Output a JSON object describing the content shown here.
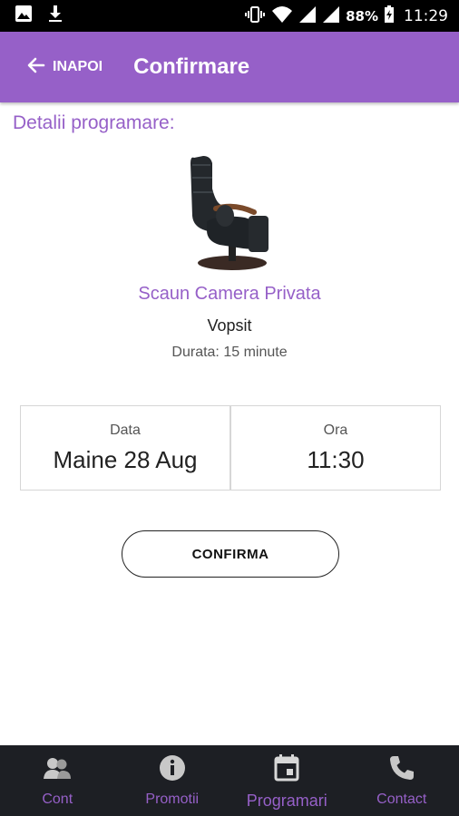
{
  "status_bar": {
    "battery": "88%",
    "time": "11:29",
    "icons": [
      "image-icon",
      "download-icon",
      "vibrate-icon",
      "wifi-icon",
      "signal-icon",
      "signal-icon",
      "battery-icon"
    ]
  },
  "header": {
    "back_label": "INAPOI",
    "title": "Confirmare"
  },
  "details": {
    "section_title": "Detalii programare:",
    "service_name": "Scaun Camera Privata",
    "service_type": "Vopsit",
    "duration": "Durata: 15 minute"
  },
  "appointment": {
    "date_label": "Data",
    "date_value": "Maine 28 Aug",
    "time_label": "Ora",
    "time_value": "11:30"
  },
  "confirm_label": "CONFIRMA",
  "bottom_nav": {
    "items": [
      {
        "label": "Cont",
        "icon": "users-icon"
      },
      {
        "label": "Promotii",
        "icon": "info-icon"
      },
      {
        "label": "Programari",
        "icon": "calendar-icon",
        "active": true
      },
      {
        "label": "Contact",
        "icon": "phone-icon"
      }
    ]
  },
  "colors": {
    "accent": "#9660c8",
    "nav_bg": "#1d1f24",
    "status_bg": "#000000"
  }
}
